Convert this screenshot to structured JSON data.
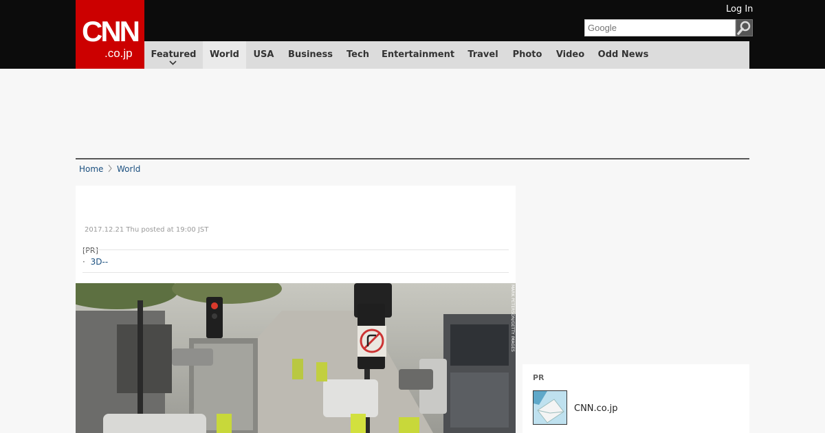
{
  "header": {
    "logo_main": "CNN",
    "logo_sub": ".co.jp",
    "login_label": "Log In",
    "search_placeholder": "Google",
    "search_icon": "magnifier-icon"
  },
  "nav": {
    "items": [
      {
        "label": "Featured",
        "active": false
      },
      {
        "label": "World",
        "active": true
      },
      {
        "label": "USA",
        "active": false
      },
      {
        "label": "Business",
        "active": false
      },
      {
        "label": "Tech",
        "active": false
      },
      {
        "label": "Entertainment",
        "active": false
      },
      {
        "label": "Travel",
        "active": false
      },
      {
        "label": "Photo",
        "active": false
      },
      {
        "label": "Video",
        "active": false
      },
      {
        "label": "Odd News",
        "active": false
      }
    ]
  },
  "breadcrumb": {
    "home": "Home",
    "separator_icon": "chevron-right-icon",
    "current": "World"
  },
  "article": {
    "meta": "2017.12.21 Thu posted at 19:00 JST",
    "pr_label": "[PR]",
    "pr_link": "3D--",
    "photo_credit": "MARK PETERSON/GETTY IMAGES"
  },
  "sidebar": {
    "pr_title": "PR",
    "pr_item": "CNN.co.jp"
  },
  "colors": {
    "header_bg": "#0c0c0c",
    "logo_red": "#cc0000",
    "nav_bg": "#dcdcdc",
    "link_blue": "#1a4f7f"
  }
}
